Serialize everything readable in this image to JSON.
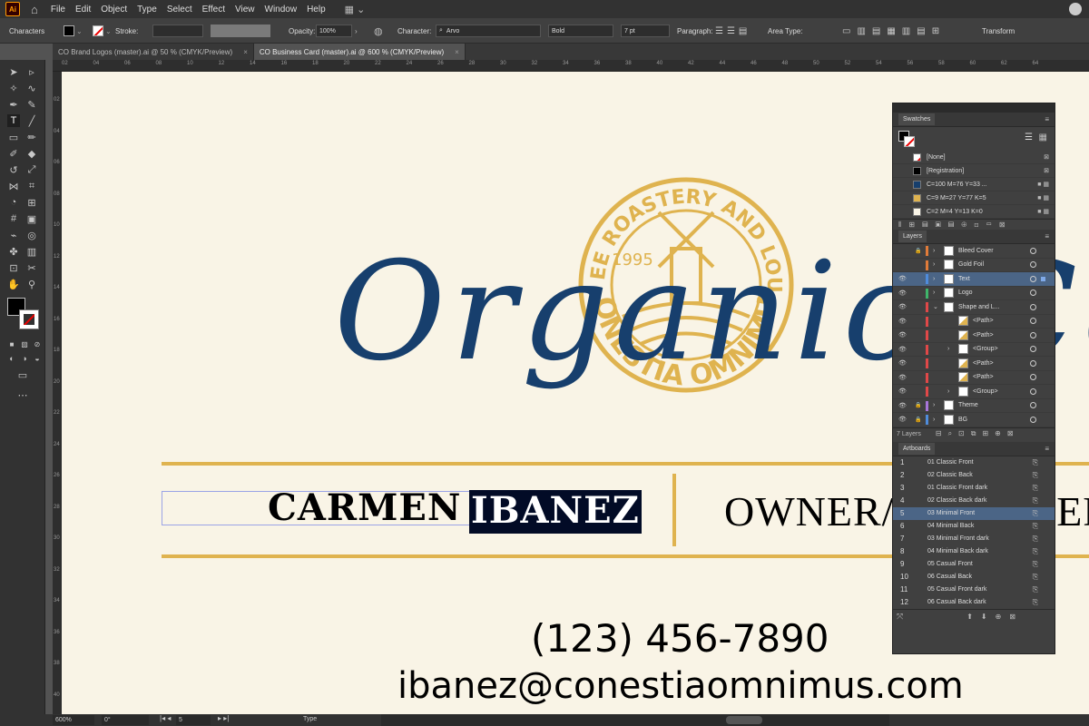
{
  "menubar": {
    "logo": "Ai",
    "items": [
      "File",
      "Edit",
      "Object",
      "Type",
      "Select",
      "Effect",
      "View",
      "Window",
      "Help"
    ]
  },
  "controlbar": {
    "panel_label": "Characters",
    "stroke_label": "Stroke:",
    "opacity_label": "Opacity:",
    "opacity_value": "100%",
    "character_label": "Character:",
    "font_family": "Arvo",
    "font_style": "Bold",
    "font_size": "7 pt",
    "paragraph_label": "Paragraph:",
    "area_type_label": "Area Type:",
    "transform_label": "Transform"
  },
  "tabs": [
    {
      "label": "CO Brand Logos (master).ai @ 50 % (CMYK/Preview)",
      "active": false
    },
    {
      "label": "CO Business Card (master).ai @ 600 % (CMYK/Preview)",
      "active": true
    }
  ],
  "ruler": {
    "top_ticks": [
      "02",
      "04",
      "06",
      "08",
      "10",
      "12",
      "14",
      "16",
      "18",
      "20",
      "22",
      "24",
      "26",
      "28",
      "30",
      "32",
      "34",
      "36",
      "38",
      "40",
      "42",
      "44",
      "46",
      "48",
      "50",
      "52",
      "54",
      "56",
      "58",
      "60",
      "62",
      "64"
    ],
    "left_ticks": [
      "02",
      "04",
      "06",
      "08",
      "10",
      "12",
      "14",
      "16",
      "18",
      "20",
      "22",
      "24",
      "26",
      "28",
      "30",
      "32",
      "34",
      "36",
      "38",
      "40"
    ]
  },
  "artwork": {
    "script_title": "Organic Cof",
    "seal_arc_top": "COFFEE ROASTERY AND LOUNGE",
    "seal_year": "1995",
    "seal_arc_bottom": "CONESTIA OMNIMUS",
    "first_name": "CARMEN",
    "last_name": "IBANEZ",
    "job_title": "OWNER/MANAGER",
    "phone": "(123) 456-7890",
    "email": "ibanez@conestiaomnimus.com",
    "colors": {
      "navy": "#173f6d",
      "gold": "#dfb34f",
      "paper": "#f9f4e6"
    }
  },
  "statusbar": {
    "zoom": "600%",
    "rotation": "0°",
    "artboard": "5",
    "tool": "Type"
  },
  "swatches": {
    "title": "Swatches",
    "rows": [
      {
        "label": "[None]",
        "chip": "none"
      },
      {
        "label": "[Registration]",
        "chip": "#000000"
      },
      {
        "label": "C=100 M=76 Y=33 ...",
        "chip": "#173f6d"
      },
      {
        "label": "C=9 M=27 Y=77 K=5",
        "chip": "#dfb34f"
      },
      {
        "label": "C=2 M=4 Y=13 K=0",
        "chip": "#f9f4e6"
      }
    ]
  },
  "layers": {
    "title": "Layers",
    "rows": [
      {
        "name": "Bleed Cover",
        "indent": 0,
        "color": "#e07b39",
        "locked": true,
        "visible": false,
        "arrow": "›",
        "selected": false
      },
      {
        "name": "Gold Foil",
        "indent": 0,
        "color": "#e07b39",
        "locked": false,
        "visible": false,
        "arrow": "›",
        "selected": false
      },
      {
        "name": "Text",
        "indent": 0,
        "color": "#4f8cdb",
        "locked": false,
        "visible": true,
        "arrow": "›",
        "selected": true
      },
      {
        "name": "Logo",
        "indent": 0,
        "color": "#3fb56a",
        "locked": false,
        "visible": true,
        "arrow": "›",
        "selected": false
      },
      {
        "name": "Shape and L...",
        "indent": 0,
        "color": "#e04848",
        "locked": false,
        "visible": true,
        "arrow": "⌄",
        "selected": false
      },
      {
        "name": "<Path>",
        "indent": 1,
        "color": "#e04848",
        "locked": false,
        "visible": true,
        "arrow": "",
        "selected": false
      },
      {
        "name": "<Path>",
        "indent": 1,
        "color": "#e04848",
        "locked": false,
        "visible": true,
        "arrow": "",
        "selected": false
      },
      {
        "name": "<Group>",
        "indent": 1,
        "color": "#e04848",
        "locked": false,
        "visible": true,
        "arrow": "›",
        "selected": false
      },
      {
        "name": "<Path>",
        "indent": 1,
        "color": "#e04848",
        "locked": false,
        "visible": true,
        "arrow": "",
        "selected": false
      },
      {
        "name": "<Path>",
        "indent": 1,
        "color": "#e04848",
        "locked": false,
        "visible": true,
        "arrow": "",
        "selected": false
      },
      {
        "name": "<Group>",
        "indent": 1,
        "color": "#e04848",
        "locked": false,
        "visible": true,
        "arrow": "›",
        "selected": false
      },
      {
        "name": "Theme",
        "indent": 0,
        "color": "#a875d9",
        "locked": true,
        "visible": true,
        "arrow": "›",
        "selected": false
      },
      {
        "name": "BG",
        "indent": 0,
        "color": "#4f8cdb",
        "locked": true,
        "visible": true,
        "arrow": "›",
        "selected": false
      }
    ],
    "footer_count": "7 Layers"
  },
  "artboards": {
    "title": "Artboards",
    "rows": [
      {
        "num": "1",
        "name": "01 Classic Front"
      },
      {
        "num": "2",
        "name": "02 Classic Back"
      },
      {
        "num": "3",
        "name": "01 Classic Front dark"
      },
      {
        "num": "4",
        "name": "02 Classic Back dark"
      },
      {
        "num": "5",
        "name": "03 Minimal Front"
      },
      {
        "num": "6",
        "name": "04 Minimal Back"
      },
      {
        "num": "7",
        "name": "03 Minimal Front dark"
      },
      {
        "num": "8",
        "name": "04 Minimal Back dark"
      },
      {
        "num": "9",
        "name": "05 Casual Front"
      },
      {
        "num": "10",
        "name": "06 Casual Back"
      },
      {
        "num": "11",
        "name": "05 Casual Front dark"
      },
      {
        "num": "12",
        "name": "06 Casual Back dark"
      }
    ],
    "selected_index": 4
  }
}
